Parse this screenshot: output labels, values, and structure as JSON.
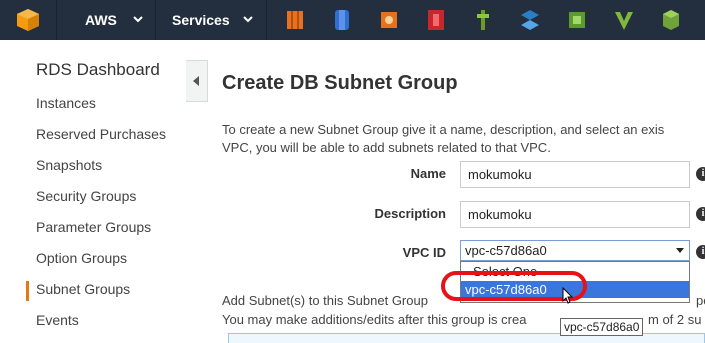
{
  "topbar": {
    "aws_label": "AWS",
    "services_label": "Services",
    "service_icons": [
      "ec2-icon",
      "s3-icon",
      "iam-icon",
      "codedeploy-icon",
      "elastic-beanstalk-icon",
      "vpc-icon",
      "cloudformation-icon",
      "opsworks-icon",
      "dynamodb-icon"
    ]
  },
  "sidebar": {
    "title": "RDS Dashboard",
    "items": [
      {
        "label": "Instances"
      },
      {
        "label": "Reserved Purchases"
      },
      {
        "label": "Snapshots"
      },
      {
        "label": "Security Groups"
      },
      {
        "label": "Parameter Groups"
      },
      {
        "label": "Option Groups"
      },
      {
        "label": "Subnet Groups",
        "active": true
      },
      {
        "label": "Events"
      }
    ]
  },
  "main": {
    "title": "Create DB Subnet Group",
    "intro_line1": "To create a new Subnet Group give it a name, description, and select an exis",
    "intro_line2": "VPC, you will be able to add subnets related to that VPC.",
    "form": {
      "name_label": "Name",
      "name_value": "mokumoku",
      "description_label": "Description",
      "description_value": "mokumoku",
      "vpc_label": "VPC ID",
      "vpc_value": "vpc-c57d86a0"
    },
    "dropdown": {
      "options": [
        "- Select One -",
        "vpc-c57d86a0"
      ],
      "selected_index": 1
    },
    "tooltip": "vpc-c57d86a0",
    "add_line1": "Add Subnet(s) to this Subnet Group",
    "add_line1_tail": "pel",
    "add_line2": "You may make additions/edits after this group is crea",
    "add_line2_tail": "m of 2 su"
  },
  "colors": {
    "topbar": "#232f3e",
    "accent": "#e47911",
    "highlight": "#e5121a",
    "selection": "#3b76dd"
  }
}
